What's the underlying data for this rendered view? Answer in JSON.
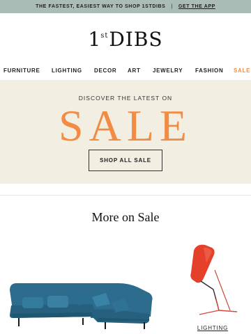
{
  "topbar": {
    "tagline": "THE FASTEST, EASIEST WAY TO SHOP 1STDIBS",
    "separator": "|",
    "app_link": "GET THE APP"
  },
  "logo": {
    "prefix": "1",
    "superscript": "st",
    "name": "DIBS"
  },
  "nav": {
    "items": [
      "FURNITURE",
      "LIGHTING",
      "DECOR",
      "ART",
      "JEWELRY",
      "FASHION",
      "SALE"
    ]
  },
  "hero": {
    "kicker": "DISCOVER THE LATEST ON",
    "headline": "SALE",
    "button": "SHOP ALL SALE"
  },
  "section": {
    "title": "More on Sale"
  },
  "products": [
    {
      "icon": "sofa-image",
      "label": ""
    },
    {
      "icon": "lamp-image",
      "label": "LIGHTING"
    }
  ],
  "colors": {
    "topbar_bg": "#a9bdb6",
    "hero_bg": "#f2eee1",
    "accent": "#f28c45",
    "sofa_blue": "#2f6f8f",
    "lamp_red": "#e8412b"
  }
}
